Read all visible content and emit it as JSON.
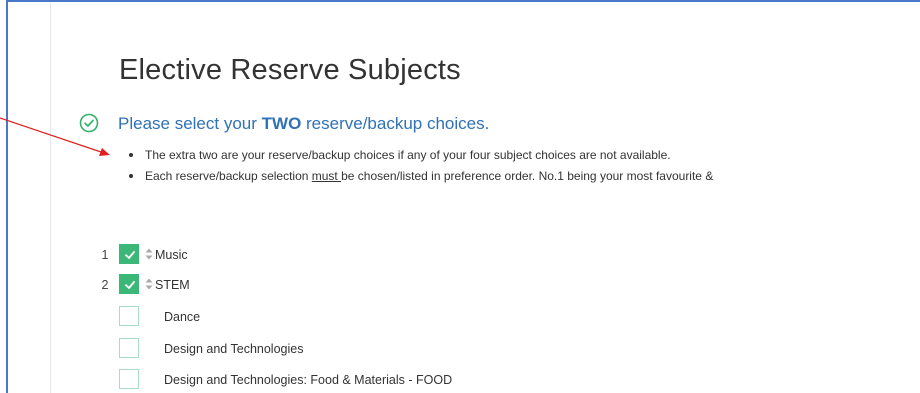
{
  "header": {
    "title": "Elective Reserve Subjects",
    "instruction_prefix": "Please select your ",
    "instruction_bold": "TWO",
    "instruction_suffix": " reserve/backup choices."
  },
  "bullets": {
    "first": "The extra two are your reserve/backup choices if any of your four subject choices are not available.",
    "second_prefix": "Each reserve/backup selection ",
    "second_underlined": "must ",
    "second_suffix": "be chosen/listed in preference order.  No.1 being your most favourite &"
  },
  "selected": [
    {
      "rank": "1",
      "label": "Music"
    },
    {
      "rank": "2",
      "label": "STEM"
    }
  ],
  "unselected": [
    {
      "label": "Dance"
    },
    {
      "label": "Design and Technologies"
    },
    {
      "label": "Design and Technologies: Food & Materials - FOOD"
    }
  ],
  "icons": {
    "status": "check-circle-icon",
    "checkbox": "checkmark-icon",
    "reorder": "sort-arrows-icon"
  },
  "colors": {
    "frame_border": "#4a78c8",
    "instruction_text": "#2f72b5",
    "checkbox_checked": "#3bb777",
    "checkbox_border": "#a8ddc4",
    "status_icon": "#33b06b",
    "annotation_arrow": "#e01f1f"
  }
}
